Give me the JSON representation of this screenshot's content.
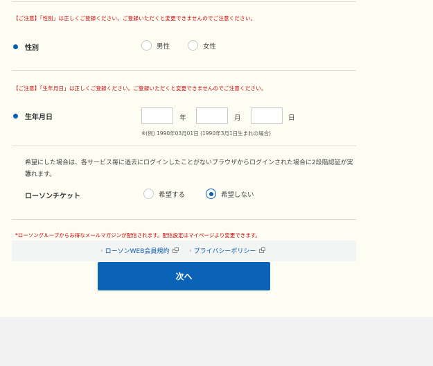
{
  "gender": {
    "caution": "【ご注意】「性別」は正しくご登録ください。ご登録いただくと変更できませんのでご注意ください。",
    "label": "性別",
    "options": [
      {
        "label": "男性",
        "selected": false
      },
      {
        "label": "女性",
        "selected": false
      }
    ]
  },
  "birthdate": {
    "caution": "【ご注意】「生年月日」は正しくご登録ください。ご登録いただくと変更できませんのでご注意ください。",
    "label": "生年月日",
    "year_unit": "年",
    "month_unit": "月",
    "day_unit": "日",
    "example": "※(例) 1990年03月01日 (1990年3月1日生まれの場合)"
  },
  "ticket": {
    "note_line1": "希望にした場合は、各サービス毎に過去にログインしたことがないブラウザからログインされた場合に2段階認証が実施",
    "note_line2": "されます。",
    "label": "ローソンチケット",
    "options": [
      {
        "label": "希望する",
        "selected": false
      },
      {
        "label": "希望しない",
        "selected": true
      }
    ]
  },
  "promo": "*ローソングループからお得なメールマガジンが配信されます。配信設定はマイページより変更できます。",
  "links": {
    "terms": "ローソンWEB会員規約",
    "privacy": "プライバシーポリシー"
  },
  "next_button": "次へ",
  "colors": {
    "accent": "#0a63b6",
    "caution": "#cc0000",
    "panel_bg": "#fdfdf4"
  }
}
